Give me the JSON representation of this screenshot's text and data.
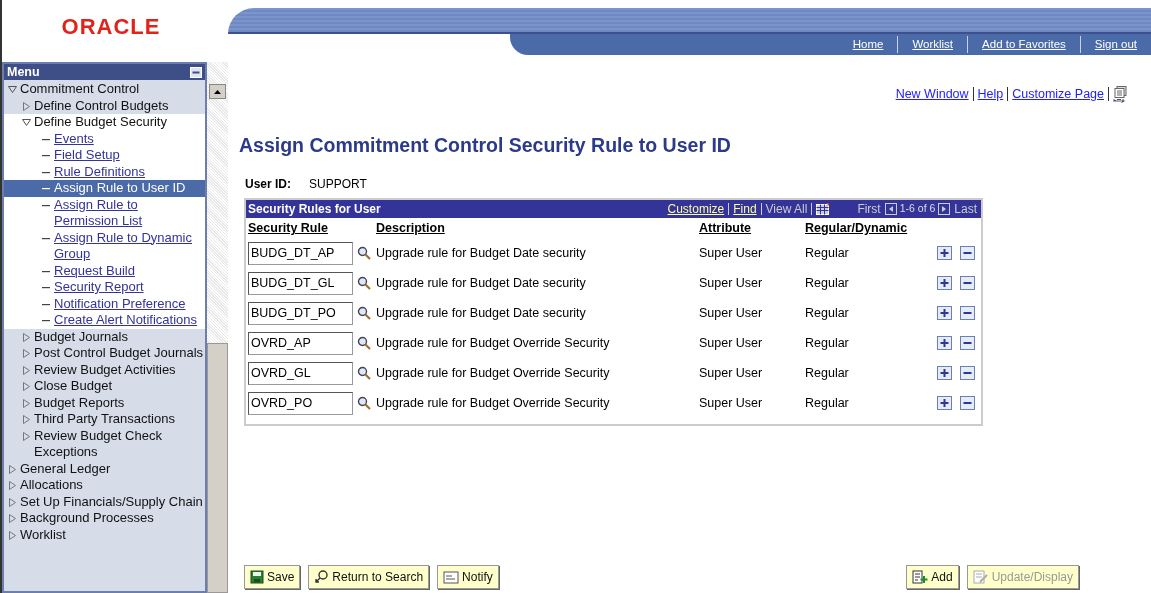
{
  "logo": "ORACLE",
  "nav_links": [
    "Home",
    "Worklist",
    "Add to Favorites",
    "Sign out"
  ],
  "sidebar": {
    "title": "Menu",
    "items": [
      {
        "kind": "folder",
        "label": "Commitment Control",
        "expanded": true,
        "children": [
          {
            "kind": "folder",
            "label": "Define Control Budgets",
            "expanded": false
          },
          {
            "kind": "folder",
            "label": "Define Budget Security",
            "expanded": true,
            "children": [
              {
                "kind": "link",
                "label": "Events",
                "selected": false
              },
              {
                "kind": "link",
                "label": "Field Setup",
                "selected": false
              },
              {
                "kind": "link",
                "label": "Rule Definitions",
                "selected": false
              },
              {
                "kind": "link",
                "label": "Assign Rule to User ID",
                "selected": true
              },
              {
                "kind": "link",
                "label": "Assign Rule to Permission List",
                "selected": false
              },
              {
                "kind": "link",
                "label": "Assign Rule to Dynamic Group",
                "selected": false
              },
              {
                "kind": "link",
                "label": "Request Build",
                "selected": false
              },
              {
                "kind": "link",
                "label": "Security Report",
                "selected": false
              },
              {
                "kind": "link",
                "label": "Notification Preference",
                "selected": false
              },
              {
                "kind": "link",
                "label": "Create Alert Notifications",
                "selected": false
              }
            ]
          },
          {
            "kind": "folder",
            "label": "Budget Journals",
            "expanded": false
          },
          {
            "kind": "folder",
            "label": "Post Control Budget Journals",
            "expanded": false
          },
          {
            "kind": "folder",
            "label": "Review Budget Activities",
            "expanded": false
          },
          {
            "kind": "folder",
            "label": "Close Budget",
            "expanded": false
          },
          {
            "kind": "folder",
            "label": "Budget Reports",
            "expanded": false
          },
          {
            "kind": "folder",
            "label": "Third Party Transactions",
            "expanded": false
          },
          {
            "kind": "folder",
            "label": "Review Budget Check Exceptions",
            "expanded": false
          }
        ]
      },
      {
        "kind": "folder",
        "label": "General Ledger",
        "expanded": false
      },
      {
        "kind": "folder",
        "label": "Allocations",
        "expanded": false
      },
      {
        "kind": "folder",
        "label": "Set Up Financials/Supply Chain",
        "expanded": false
      },
      {
        "kind": "folder",
        "label": "Background Processes",
        "expanded": false
      },
      {
        "kind": "folder",
        "label": "Worklist",
        "expanded": false
      }
    ]
  },
  "page_links": [
    "New Window",
    "Help",
    "Customize Page"
  ],
  "page_title": "Assign Commitment Control Security Rule to User ID",
  "user_id": {
    "label": "User ID:",
    "value": "SUPPORT"
  },
  "grid": {
    "title": "Security Rules for User",
    "tools": [
      "Customize",
      "Find"
    ],
    "view_all": "View All",
    "first": "First",
    "range": "1-6 of 6",
    "last": "Last",
    "columns": [
      "Security Rule",
      "Description",
      "Attribute",
      "Regular/Dynamic"
    ],
    "rows": [
      {
        "rule": "BUDG_DT_AP",
        "description": "Upgrade rule for Budget Date security",
        "attribute": "Super User",
        "type": "Regular"
      },
      {
        "rule": "BUDG_DT_GL",
        "description": "Upgrade rule for Budget Date security",
        "attribute": "Super User",
        "type": "Regular"
      },
      {
        "rule": "BUDG_DT_PO",
        "description": "Upgrade rule for Budget Date security",
        "attribute": "Super User",
        "type": "Regular"
      },
      {
        "rule": "OVRD_AP",
        "description": "Upgrade rule for Budget Override Security",
        "attribute": "Super User",
        "type": "Regular"
      },
      {
        "rule": "OVRD_GL",
        "description": "Upgrade rule for Budget Override Security",
        "attribute": "Super User",
        "type": "Regular"
      },
      {
        "rule": "OVRD_PO",
        "description": "Upgrade rule for Budget Override Security",
        "attribute": "Super User",
        "type": "Regular"
      }
    ]
  },
  "buttons_left": [
    {
      "kind": "save",
      "label": "Save",
      "disabled": false
    },
    {
      "kind": "search",
      "label": "Return to Search",
      "disabled": false
    },
    {
      "kind": "notify",
      "label": "Notify",
      "disabled": false
    }
  ],
  "buttons_right": [
    {
      "kind": "add",
      "label": "Add",
      "disabled": false
    },
    {
      "kind": "update",
      "label": "Update/Display",
      "disabled": true
    }
  ]
}
